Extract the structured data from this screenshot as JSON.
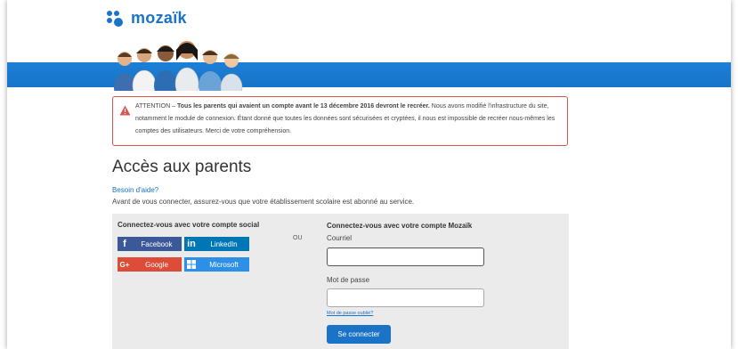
{
  "brand": {
    "name": "mozaïk"
  },
  "alert": {
    "prefix": "ATTENTION – ",
    "bold": "Tous les parents qui avaient un compte avant le 13 décembre 2016 devront le recréer.",
    "rest": " Nous avons modifié l'infrastructure du site, notamment le module de connexion. Étant donné que toutes les données sont sécurisées et cryptées, il nous est impossible de recréer nous-mêmes les comptes des utilisateurs. Merci de votre compréhension."
  },
  "main": {
    "title": "Accès aux parents",
    "help_link": "Besoin d'aide?",
    "help_text": "Avant de vous connecter, assurez-vous que votre établissement scolaire est abonné au service."
  },
  "social": {
    "title": "Connectez-vous avec votre compte social",
    "facebook": "Facebook",
    "linkedin": "LinkedIn",
    "google": "Google",
    "microsoft": "Microsoft",
    "separator": "OU"
  },
  "mozaik_login": {
    "title": "Connectez-vous avec votre compte Mozaïk",
    "email_label": "Courriel",
    "email_value": "",
    "password_label": "Mot de passe",
    "password_value": "",
    "forgot": "Mot de passe oublié?",
    "submit": "Se connecter"
  },
  "colors": {
    "brand_blue": "#1a73c7",
    "alert_border": "#d9534f",
    "facebook": "#3b5998",
    "linkedin": "#0077b5",
    "google": "#dd4b39",
    "microsoft": "#2e8fe6"
  },
  "icons": {
    "logo": "mozaik-logo-icon",
    "alert": "warning-triangle-icon",
    "facebook": "facebook-icon",
    "linkedin": "linkedin-icon",
    "google": "google-plus-icon",
    "microsoft": "microsoft-icon"
  }
}
